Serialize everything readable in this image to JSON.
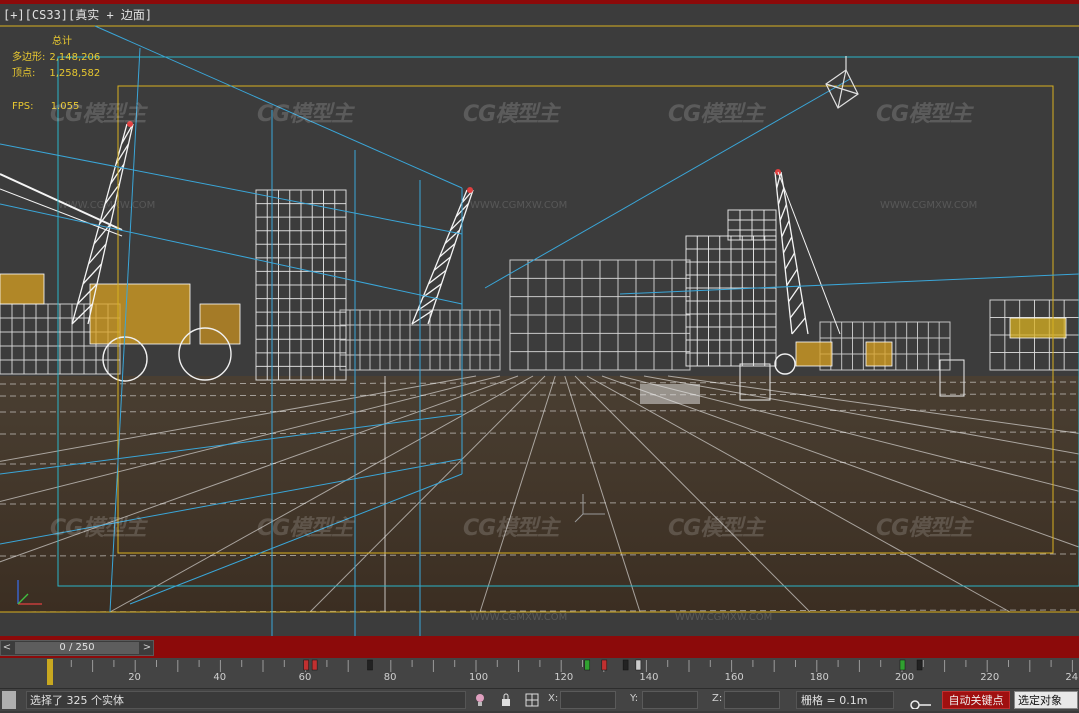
{
  "viewport": {
    "label": "[+][CS33][真实 + 边面]",
    "stats": {
      "header": "总计",
      "polys_label": "多边形:",
      "polys_value": "2,148,206",
      "verts_label": "顶点:",
      "verts_value": "1,258,582",
      "fps_label": "FPS:",
      "fps_value": "1.055"
    },
    "watermark_logo": "CG模型主",
    "watermark_url": "WWW.CGMXW.COM"
  },
  "timeline": {
    "frame_display": "0 / 250",
    "prev_label": "<",
    "next_label": ">",
    "ruler_labels": [
      "20",
      "40",
      "60",
      "80",
      "100",
      "120",
      "140",
      "160",
      "180",
      "200",
      "220",
      "24"
    ]
  },
  "status": {
    "selection_text": "选择了 325 个实体",
    "x_label": "X:",
    "y_label": "Y:",
    "z_label": "Z:",
    "grid_text": "栅格 = 0.1m",
    "autokey_label": "自动关键点",
    "selected_label": "选定对象"
  },
  "colors": {
    "accent_red": "#8c0a0a",
    "stats_yellow": "#e8c830",
    "safe_frame_yellow": "#d8b020",
    "safe_frame_cyan": "#2ab4c8"
  }
}
